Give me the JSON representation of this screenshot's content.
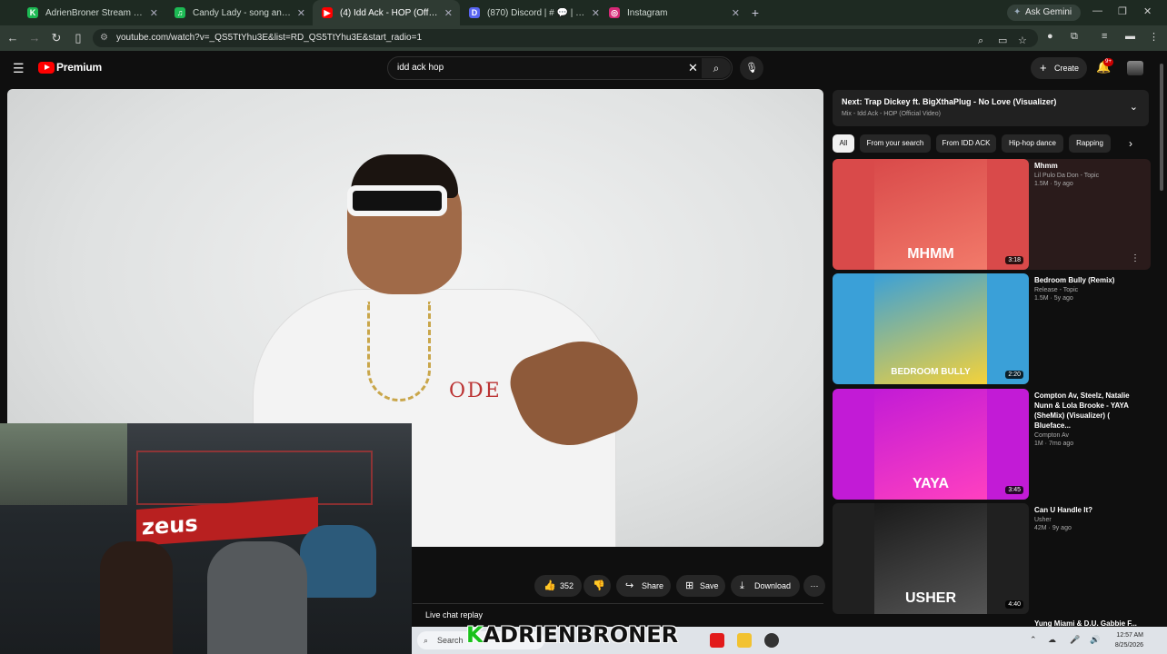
{
  "browser": {
    "tabs": [
      {
        "label": "AdrienBroner Stream - Watch l",
        "fav": "K",
        "color": "#1db954"
      },
      {
        "label": "Candy Lady - song and lyrics by",
        "fav": "♫",
        "color": "#1db954"
      },
      {
        "label": "(4) Idd Ack - HOP (Official V",
        "fav": "▶",
        "color": "#ff0000",
        "active": true
      },
      {
        "label": "(870) Discord | # 💬 | reaction",
        "fav": "D",
        "color": "#5865f2"
      },
      {
        "label": "Instagram",
        "fav": "◎",
        "color": "#d62976"
      }
    ],
    "new_tab": "+",
    "gemini_label": "Ask Gemini",
    "url": "youtube.com/watch?v=_QS5TtYhu3E&list=RD_QS5TtYhu3E&start_radio=1"
  },
  "youtube": {
    "brand": "Premium",
    "search_query": "idd ack hop",
    "create_label": "Create",
    "notification_count": "9+",
    "actions": {
      "likes": "352",
      "share": "Share",
      "save": "Save",
      "download": "Download"
    },
    "live_chat": "Live chat replay",
    "video_shirt_text": "ODE",
    "up_next": {
      "title": "Next: Trap Dickey ft. BigXthaPlug - No Love (Visualizer)",
      "subtitle": "Mix - Idd Ack - HOP (Official Video)"
    },
    "chips": [
      "All",
      "From your search",
      "From IDD ACK",
      "Hip-hop dance",
      "Rapping"
    ],
    "recommendations": [
      {
        "title": "Mhmm",
        "channel": "Lil Pulo Da Don - Topic",
        "meta": "1.5M · 5y ago",
        "duration": "3:18",
        "art_text": "MHMM",
        "colors": [
          "#d94a4a",
          "#f27a6a"
        ]
      },
      {
        "title": "Bedroom Bully (Remix)",
        "channel": "Release - Topic",
        "meta": "1.5M · 5y ago",
        "duration": "2:20",
        "art_text": "BEDROOM BULLY",
        "colors": [
          "#3aa0d8",
          "#f4d23a"
        ]
      },
      {
        "title": "Compton Av, Steelz, Natalie Nunn & Lola Brooke - YAYA (SheMix) (Visualizer) ( Blueface...",
        "channel": "Compton Av",
        "meta": "1M · 7mo ago",
        "duration": "3:45",
        "art_text": "YAYA",
        "colors": [
          "#c21bd6",
          "#ff40c0"
        ]
      },
      {
        "title": "Can U Handle It?",
        "channel": "Usher",
        "meta": "42M · 9y ago",
        "duration": "4:40",
        "art_text": "USHER",
        "colors": [
          "#1a1a1a",
          "#555555"
        ]
      }
    ],
    "partial_next": "Yung Miami & D.U. Gabbie F..."
  },
  "stream": {
    "cam_sign": "zeus",
    "overlay_brand": "ADRIENBRONER",
    "overlay_brand_k": "K"
  },
  "taskbar": {
    "search_placeholder": "Search",
    "time": "12:57 AM",
    "date": "8/25/2026"
  }
}
